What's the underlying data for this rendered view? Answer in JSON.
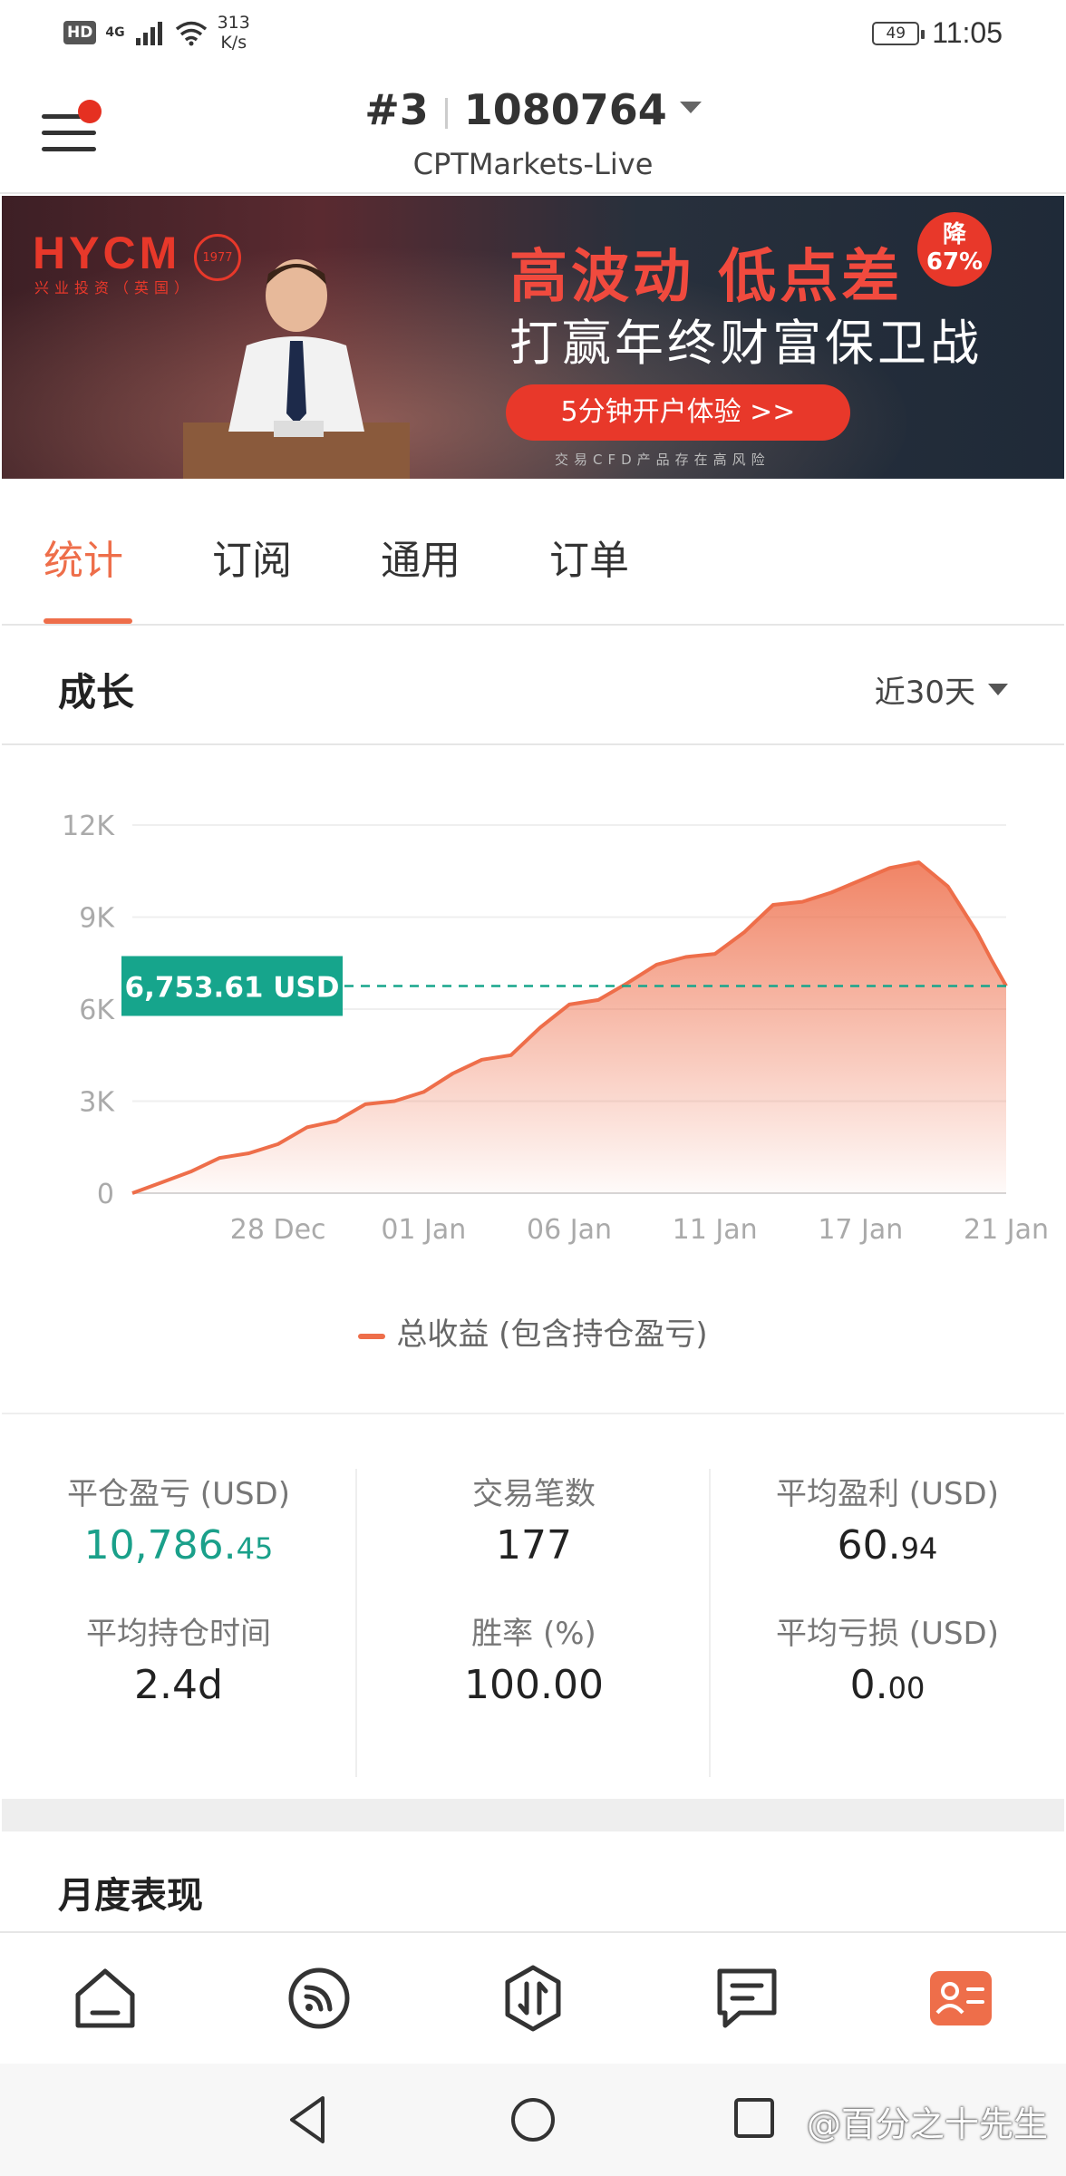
{
  "status_bar": {
    "hd": "HD",
    "network": "4G",
    "speed_value": "313",
    "speed_unit": "K/s",
    "battery": "49",
    "time": "11:05"
  },
  "header": {
    "rank": "#3",
    "account": "1080764",
    "broker": "CPTMarkets-Live"
  },
  "banner": {
    "logo": "HYCM",
    "logo_sub": "兴业投资（英国）",
    "seal": "1977",
    "headline": "高波动 低点差",
    "subheadline": "打赢年终财富保卫战",
    "badge_line1": "降",
    "badge_line2": "67%",
    "cta": "5分钟开户体验 >>",
    "note": "交易CFD产品存在高风险"
  },
  "tabs": [
    {
      "label": "统计",
      "active": true
    },
    {
      "label": "订阅",
      "active": false
    },
    {
      "label": "通用",
      "active": false
    },
    {
      "label": "订单",
      "active": false
    }
  ],
  "growth": {
    "title": "成长",
    "range": "近30天"
  },
  "chart_data": {
    "type": "area",
    "title": "",
    "xlabel": "",
    "ylabel": "",
    "ylim": [
      0,
      12000
    ],
    "y_ticks": [
      "12K",
      "9K",
      "6K",
      "3K",
      "0"
    ],
    "y_tick_values": [
      12000,
      9000,
      6000,
      3000,
      0
    ],
    "x_ticks": [
      "28 Dec",
      "01 Jan",
      "06 Jan",
      "11 Jan",
      "17 Jan",
      "21 Jan"
    ],
    "x_tick_values": [
      5,
      10,
      15,
      20,
      25,
      30
    ],
    "xlim": [
      0,
      30
    ],
    "grid": true,
    "legend_position": "bottom",
    "series": [
      {
        "name": "总收益 (包含持仓盈亏)",
        "color": "#ee6e4a",
        "x": [
          0,
          1,
          2,
          3,
          4,
          5,
          6,
          7,
          8,
          9,
          10,
          11,
          12,
          13,
          14,
          15,
          16,
          17,
          18,
          19,
          20,
          21,
          22,
          23,
          24,
          25,
          26,
          27,
          28,
          29,
          29.5,
          30
        ],
        "values": [
          0,
          350,
          700,
          1150,
          1300,
          1600,
          2150,
          2350,
          2900,
          3000,
          3300,
          3900,
          4350,
          4500,
          5400,
          6150,
          6300,
          6850,
          7450,
          7700,
          7800,
          8500,
          9400,
          9500,
          9800,
          10200,
          10600,
          10786,
          10000,
          8500,
          7600,
          6754
        ]
      }
    ],
    "marker": {
      "label": "6,753.61 USD",
      "value": 6753.61,
      "color": "#16a58c"
    }
  },
  "stats": {
    "closed_pl_label": "平仓盈亏 (USD)",
    "closed_pl_int": "10,786.",
    "closed_pl_dec": "45",
    "trades_label": "交易笔数",
    "trades_value": "177",
    "avg_profit_label": "平均盈利 (USD)",
    "avg_profit_int": "60.",
    "avg_profit_dec": "94",
    "avg_hold_label": "平均持仓时间",
    "avg_hold_value": "2.4d",
    "win_rate_label": "胜率 (%)",
    "win_rate_value": "100.00",
    "avg_loss_label": "平均亏损 (USD)",
    "avg_loss_int": "0.",
    "avg_loss_dec": "00"
  },
  "monthly": {
    "title": "月度表现"
  },
  "bottom_nav": [
    {
      "icon": "home-icon"
    },
    {
      "icon": "feed-icon"
    },
    {
      "icon": "trade-icon"
    },
    {
      "icon": "message-icon"
    },
    {
      "icon": "profile-card-icon",
      "active": true
    }
  ],
  "watermark": "@百分之十先生",
  "colors": {
    "accent": "#ee6e4a",
    "positive": "#16a58c"
  }
}
